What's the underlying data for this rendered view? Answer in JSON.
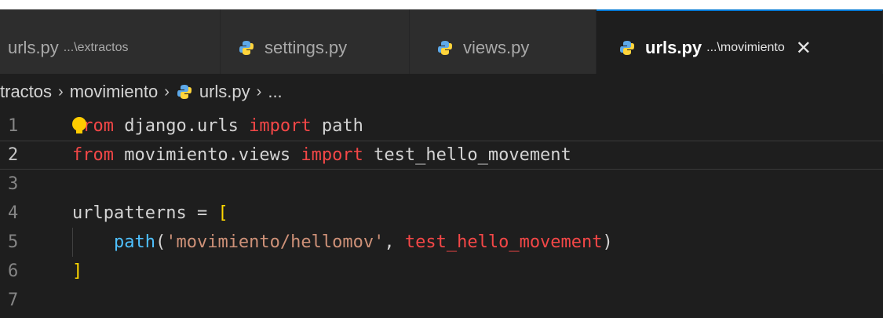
{
  "tabs": [
    {
      "name": "urls.py",
      "description": "...\\extractos",
      "active": false,
      "icon": "python-icon"
    },
    {
      "name": "settings.py",
      "description": "",
      "active": false,
      "icon": "python-icon"
    },
    {
      "name": "views.py",
      "description": "",
      "active": false,
      "icon": "python-icon"
    },
    {
      "name": "urls.py",
      "description": "...\\movimiento",
      "active": true,
      "icon": "python-icon",
      "close": "✕"
    }
  ],
  "breadcrumb": {
    "items": [
      "tractos",
      "movimiento",
      "urls.py",
      "..."
    ],
    "separator": "›"
  },
  "editor": {
    "current_line": 2,
    "lines": [
      {
        "number": "1",
        "tokens": [
          {
            "t": "from",
            "c": "red"
          },
          {
            "t": " django.urls ",
            "c": "plain"
          },
          {
            "t": "import",
            "c": "kw2"
          },
          {
            "t": " path",
            "c": "plain"
          }
        ]
      },
      {
        "number": "2",
        "tokens": [
          {
            "t": "from",
            "c": "red"
          },
          {
            "t": " movimiento.views ",
            "c": "plain"
          },
          {
            "t": "import",
            "c": "kw2"
          },
          {
            "t": " test_hello_movement",
            "c": "plain"
          }
        ]
      },
      {
        "number": "3",
        "tokens": []
      },
      {
        "number": "4",
        "tokens": [
          {
            "t": "urlpatterns",
            "c": "plain"
          },
          {
            "t": " = ",
            "c": "plain"
          },
          {
            "t": "[",
            "c": "brk"
          }
        ]
      },
      {
        "number": "5",
        "tokens": [
          {
            "t": "    ",
            "c": "plain"
          },
          {
            "t": "path",
            "c": "fn"
          },
          {
            "t": "(",
            "c": "plain"
          },
          {
            "t": "'movimiento/hellomov'",
            "c": "str"
          },
          {
            "t": ", ",
            "c": "plain"
          },
          {
            "t": "test_hello_movement",
            "c": "red"
          },
          {
            "t": ")",
            "c": "plain"
          }
        ]
      },
      {
        "number": "6",
        "tokens": [
          {
            "t": "]",
            "c": "brk"
          }
        ]
      },
      {
        "number": "7",
        "tokens": []
      }
    ]
  },
  "colors": {
    "editor_bg": "#1e1e1e",
    "tab_bg": "#2d2d2d",
    "active_tab_accent": "#0078d4",
    "keyword": "#f44747",
    "string": "#ce9178",
    "bracket": "#ffd700",
    "function": "#4fc1ff",
    "lightbulb": "#ffcc00"
  }
}
